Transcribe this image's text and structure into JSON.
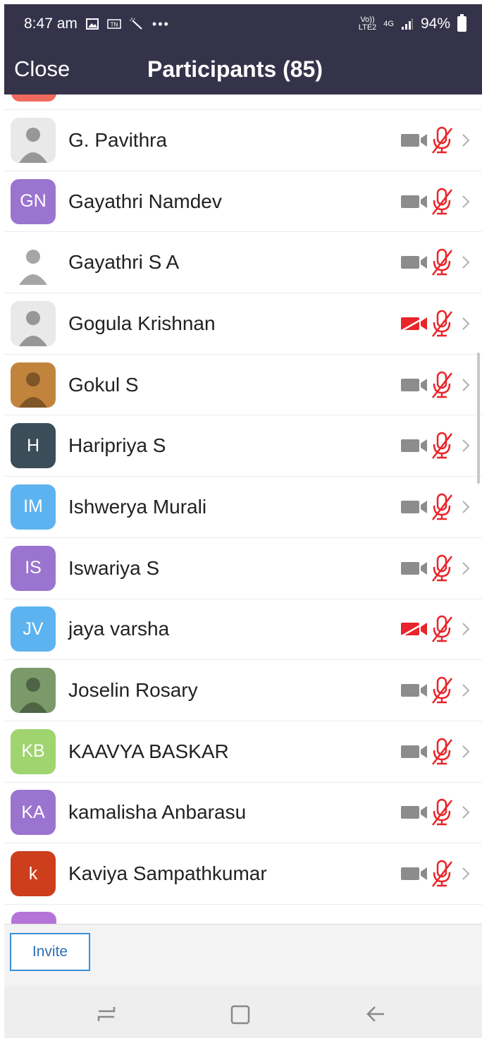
{
  "status_bar": {
    "time": "8:47 am",
    "icons": [
      "image-icon",
      "tn-icon",
      "magic-wand-icon",
      "more-dots-icon"
    ],
    "network": {
      "volte": "Vo))",
      "lte": "LTE2",
      "gen": "4G"
    },
    "battery": "94%"
  },
  "header": {
    "close_label": "Close",
    "title": "Participants (85)"
  },
  "participants": [
    {
      "name": "G. Pavithra",
      "avatar_type": "image",
      "initials": "",
      "avatar_color": "#e9e9e9",
      "video_off": false
    },
    {
      "name": "Gayathri Namdev",
      "avatar_type": "initials",
      "initials": "GN",
      "avatar_color": "#9b74cf",
      "video_off": false
    },
    {
      "name": "Gayathri S A",
      "avatar_type": "image",
      "initials": "",
      "avatar_color": "#ffffff",
      "video_off": false
    },
    {
      "name": "Gogula Krishnan",
      "avatar_type": "image",
      "initials": "",
      "avatar_color": "#e9e9e9",
      "video_off": true
    },
    {
      "name": "Gokul S",
      "avatar_type": "image",
      "initials": "",
      "avatar_color": "#c2843d",
      "video_off": false
    },
    {
      "name": "Haripriya S",
      "avatar_type": "initials",
      "initials": "H",
      "avatar_color": "#3b4d59",
      "video_off": false
    },
    {
      "name": "Ishwerya Murali",
      "avatar_type": "initials",
      "initials": "IM",
      "avatar_color": "#5cb3f0",
      "video_off": false
    },
    {
      "name": "Iswariya S",
      "avatar_type": "initials",
      "initials": "IS",
      "avatar_color": "#9b74cf",
      "video_off": false
    },
    {
      "name": "jaya varsha",
      "avatar_type": "initials",
      "initials": "JV",
      "avatar_color": "#5cb3f0",
      "video_off": true
    },
    {
      "name": "Joselin Rosary",
      "avatar_type": "image",
      "initials": "",
      "avatar_color": "#7a9a6a",
      "video_off": false
    },
    {
      "name": "KAAVYA BASKAR",
      "avatar_type": "initials",
      "initials": "KB",
      "avatar_color": "#9fd46e",
      "video_off": false
    },
    {
      "name": "kamalisha Anbarasu",
      "avatar_type": "initials",
      "initials": "KA",
      "avatar_color": "#9b74cf",
      "video_off": false
    },
    {
      "name": "Kaviya Sampathkumar",
      "avatar_type": "initials",
      "initials": "k",
      "avatar_color": "#cc3e1c",
      "video_off": false
    }
  ],
  "footer": {
    "invite_label": "Invite"
  },
  "colors": {
    "header_bg": "#35334a",
    "mic_muted": "#e8252a",
    "camera_on": "#8c8c8c",
    "camera_off": "#e8252a",
    "invite_border": "#3a8fd8"
  },
  "system_nav": [
    "recent-apps-icon",
    "home-icon",
    "back-icon"
  ]
}
